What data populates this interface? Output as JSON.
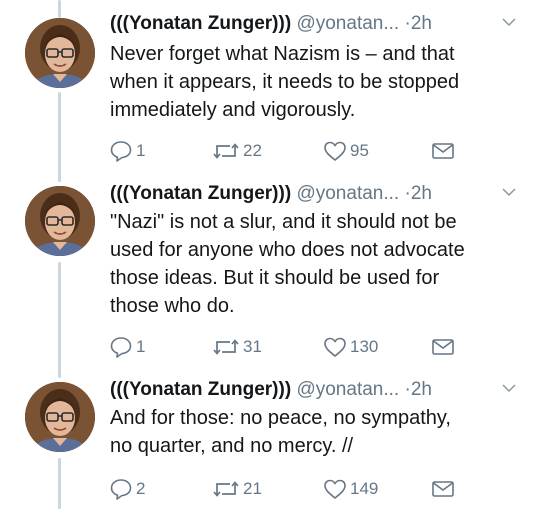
{
  "tweets": [
    {
      "name": "(((Yonatan Zunger)))",
      "handle": "@yonatan...",
      "separator": "·",
      "time": "2h",
      "text_lines": [
        "Never forget what Nazism is – and that",
        "when it appears, it needs to be stopped",
        "immediately and vigorously."
      ],
      "replies": "1",
      "retweets": "22",
      "likes": "95"
    },
    {
      "name": "(((Yonatan Zunger)))",
      "handle": "@yonatan...",
      "separator": "·",
      "time": "2h",
      "text_lines": [
        "\"Nazi\" is not a slur, and it should not be",
        "used for anyone who does not advocate",
        "those ideas. But it should be used for",
        "those who do."
      ],
      "replies": "1",
      "retweets": "31",
      "likes": "130"
    },
    {
      "name": "(((Yonatan Zunger)))",
      "handle": "@yonatan...",
      "separator": "·",
      "time": "2h",
      "text_lines": [
        "And for those: no peace, no sympathy,",
        "no quarter, and no mercy. //"
      ],
      "replies": "2",
      "retweets": "21",
      "likes": "149"
    }
  ],
  "icons": {
    "reply": "reply-icon",
    "retweet": "retweet-icon",
    "like": "heart-icon",
    "dm": "envelope-icon",
    "caret": "chevron-down-icon",
    "avatar": "avatar"
  },
  "colors": {
    "text": "#14171a",
    "secondary": "#657786",
    "thread_line": "#ccd6dd"
  }
}
